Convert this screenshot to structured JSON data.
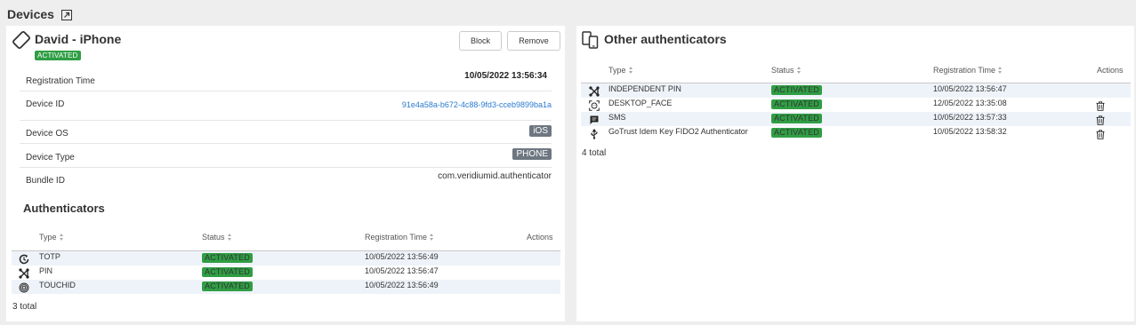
{
  "page": {
    "title": "Devices"
  },
  "device": {
    "name": "David - iPhone",
    "status": "ACTIVATED",
    "block_label": "Block",
    "remove_label": "Remove",
    "registration_time_value": "10/05/2022 13:56:34",
    "details": [
      {
        "label": "Registration Time",
        "value": ""
      },
      {
        "label": "Device ID",
        "value": "91e4a58a-b672-4c88-9fd3-cceb9899ba1a"
      },
      {
        "label": "Device OS",
        "value": "iOS"
      },
      {
        "label": "Device Type",
        "value": "PHONE"
      },
      {
        "label": "Bundle ID",
        "value": "com.veridiumid.authenticator"
      }
    ]
  },
  "authenticators": {
    "title": "Authenticators",
    "columns": {
      "type": "Type",
      "status": "Status",
      "registration_time": "Registration Time",
      "actions": "Actions"
    },
    "rows": [
      {
        "icon": "totp-icon",
        "type": "TOTP",
        "status": "ACTIVATED",
        "time": "10/05/2022 13:56:49"
      },
      {
        "icon": "pin-icon",
        "type": "PIN",
        "status": "ACTIVATED",
        "time": "10/05/2022 13:56:47"
      },
      {
        "icon": "fingerprint-icon",
        "type": "TOUCHID",
        "status": "ACTIVATED",
        "time": "10/05/2022 13:56:49"
      }
    ],
    "total": "3 total"
  },
  "other_authenticators": {
    "title": "Other authenticators",
    "columns": {
      "type": "Type",
      "status": "Status",
      "registration_time": "Registration Time",
      "actions": "Actions"
    },
    "rows": [
      {
        "icon": "pin-icon",
        "type": "INDEPENDENT PIN",
        "status": "ACTIVATED",
        "time": "10/05/2022 13:56:47",
        "deletable": false
      },
      {
        "icon": "face-scan-icon",
        "type": "DESKTOP_FACE",
        "status": "ACTIVATED",
        "time": "12/05/2022 13:35:08",
        "deletable": true
      },
      {
        "icon": "sms-icon",
        "type": "SMS",
        "status": "ACTIVATED",
        "time": "10/05/2022 13:57:33",
        "deletable": true
      },
      {
        "icon": "usb-icon",
        "type": "GoTrust Idem Key FIDO2 Authenticator",
        "status": "ACTIVATED",
        "time": "10/05/2022 13:58:32",
        "deletable": true
      }
    ],
    "total": "4 total"
  },
  "colors": {
    "activated": "#2f9e44",
    "link": "#2b7bd1",
    "pill": "#6e7781",
    "row_alt": "#eef3f9"
  }
}
